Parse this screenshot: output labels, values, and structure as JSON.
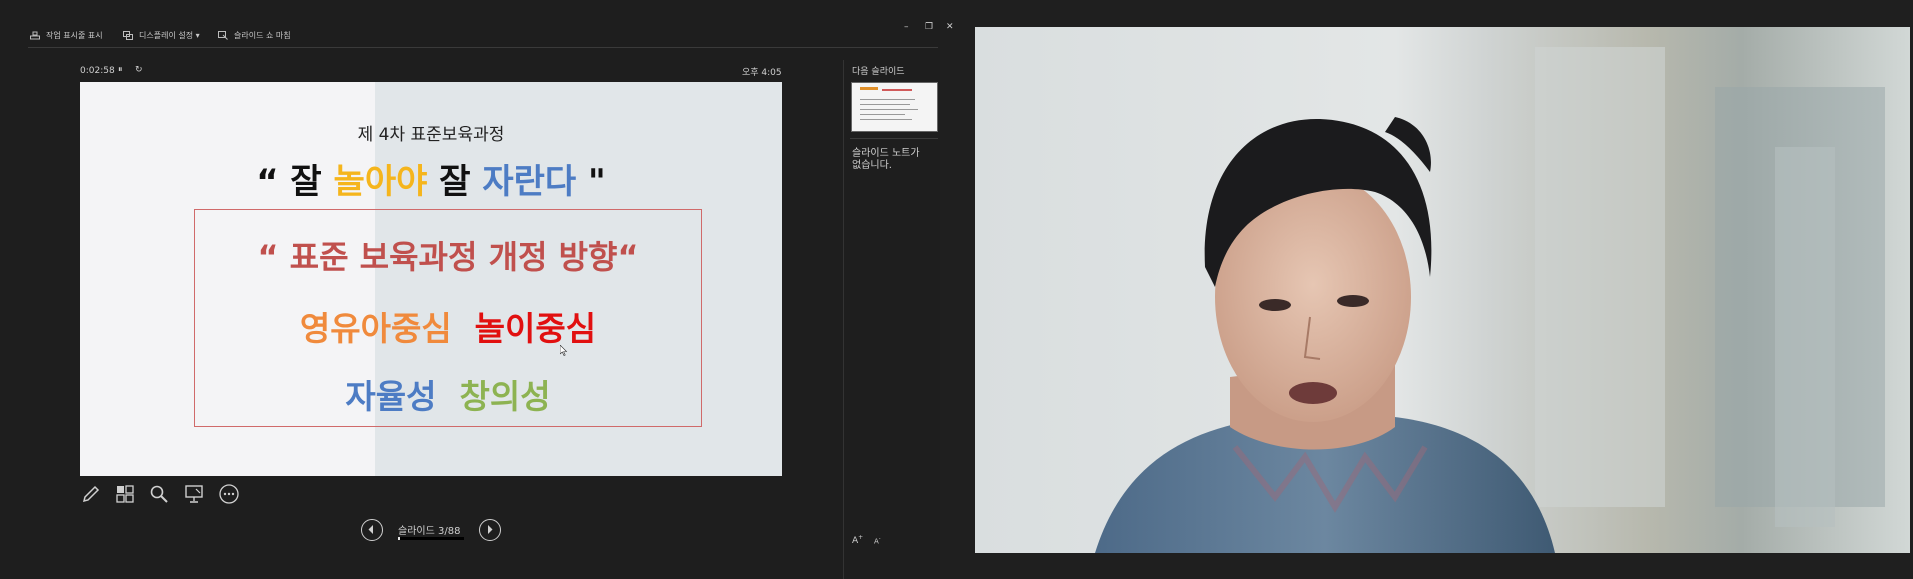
{
  "toolbar": {
    "taskbar_label": "작업 표시줄 표시",
    "display_settings_label": "디스플레이 설정 ▾",
    "end_show_label": "슬라이드 쇼 마침"
  },
  "window_controls": {
    "minimize": "–",
    "restore": "❐",
    "close": "✕"
  },
  "timer": {
    "elapsed": "0:02:58",
    "pause_glyph": "⏸",
    "reset_glyph": "↻",
    "clock": "오후 4:05"
  },
  "slide": {
    "subtitle": "제 4차 표준보육과정",
    "headline": {
      "open_quote": "“ ",
      "word1": "잘 ",
      "word2": "놀아야",
      "word3": " 잘 ",
      "word4": "자란다",
      "close_quote": " \""
    },
    "box_title": "“ 표준 보육과정 개정 방향“",
    "row2": {
      "left": "영유아중심",
      "right": "놀이중심"
    },
    "row3": {
      "left": "자율성",
      "right": "창의성"
    },
    "colors": {
      "black": "#111111",
      "yellow": "#f5b51c",
      "blue": "#4d7cc4",
      "red": "#c0504d",
      "orange": "#f08a3c",
      "bright_red": "#e11010",
      "green": "#8db352"
    }
  },
  "slide_tools": [
    "pen-icon",
    "grid-icon",
    "magnifier-icon",
    "presenter-screen-icon",
    "more-icon"
  ],
  "navigation": {
    "counter": "슬라이드 3/88",
    "progress": 0.034
  },
  "next_slide_label": "다음 슬라이드",
  "notes": "슬라이드 노트가 없습니다.",
  "font_size_buttons": {
    "increase": "A",
    "decrease": "A"
  }
}
